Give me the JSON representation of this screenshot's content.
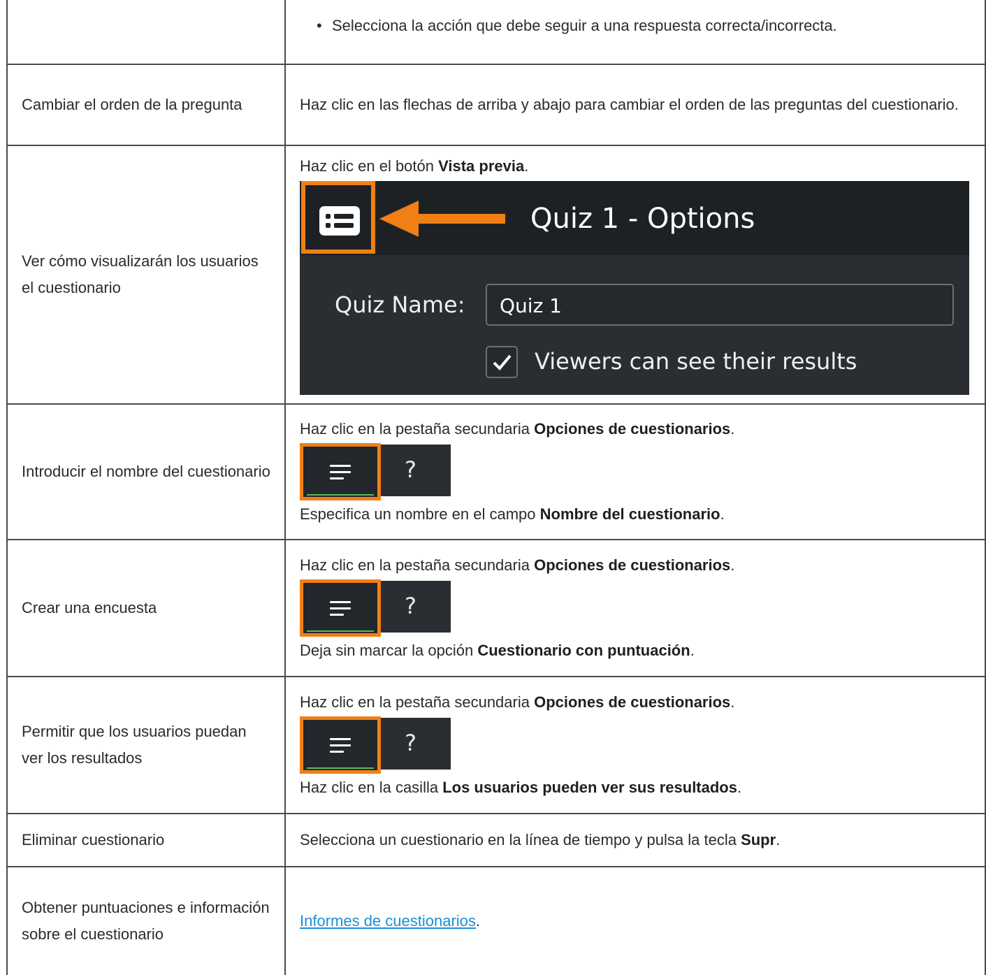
{
  "rows": [
    {
      "action": "",
      "parts": [
        "Selecciona la acción que debe seguir a una respuesta correcta/incorrecta."
      ]
    },
    {
      "action": "Cambiar el orden de la pregunta",
      "parts": [
        "Haz clic en las flechas de arriba y abajo para cambiar el orden de las preguntas del cuestionario."
      ]
    },
    {
      "action": "Ver cómo visualizarán los usuarios el cuestionario",
      "parts": [
        "Haz clic en el botón ",
        "Vista previa",
        "."
      ]
    },
    {
      "action": "Introducir el nombre del cuestionario",
      "parts": [
        "Haz clic en la pestaña secundaria ",
        "Opciones de cuestionarios",
        "."
      ],
      "after": [
        "Especifica un nombre en el campo ",
        "Nombre del cuestionario",
        "."
      ]
    },
    {
      "action": "Crear una encuesta",
      "parts": [
        "Haz clic en la pestaña secundaria ",
        "Opciones de cuestionarios",
        "."
      ],
      "after": [
        "Deja sin marcar la opción ",
        "Cuestionario con puntuación",
        "."
      ]
    },
    {
      "action": "Permitir que los usuarios puedan ver los resultados",
      "parts": [
        "Haz clic en la pestaña secundaria ",
        "Opciones de cuestionarios",
        "."
      ],
      "after": [
        "Haz clic en la casilla ",
        "Los usuarios pueden ver sus resultados",
        "."
      ]
    },
    {
      "action": "Eliminar cuestionario",
      "parts": [
        "Selecciona un cuestionario en la línea de tiempo y pulsa la tecla ",
        "Supr",
        "."
      ]
    },
    {
      "action": "Obtener puntuaciones e información sobre el cuestionario",
      "link": "Informes de cuestionarios",
      "link_suffix": "."
    }
  ],
  "preview_screenshot": {
    "title": "Quiz 1 - Options",
    "name_label": "Quiz Name:",
    "name_value": "Quiz 1",
    "checkbox_label": "Viewers can see their results",
    "checkbox_checked": true,
    "icon": "preview-button-icon"
  },
  "tab_screenshot": {
    "active_icon": "menu-lines-icon",
    "inactive_label": "?"
  },
  "colors": {
    "highlight": "#f07f16",
    "link": "#1a8fd6",
    "dark_ui": "#2a2d31"
  }
}
